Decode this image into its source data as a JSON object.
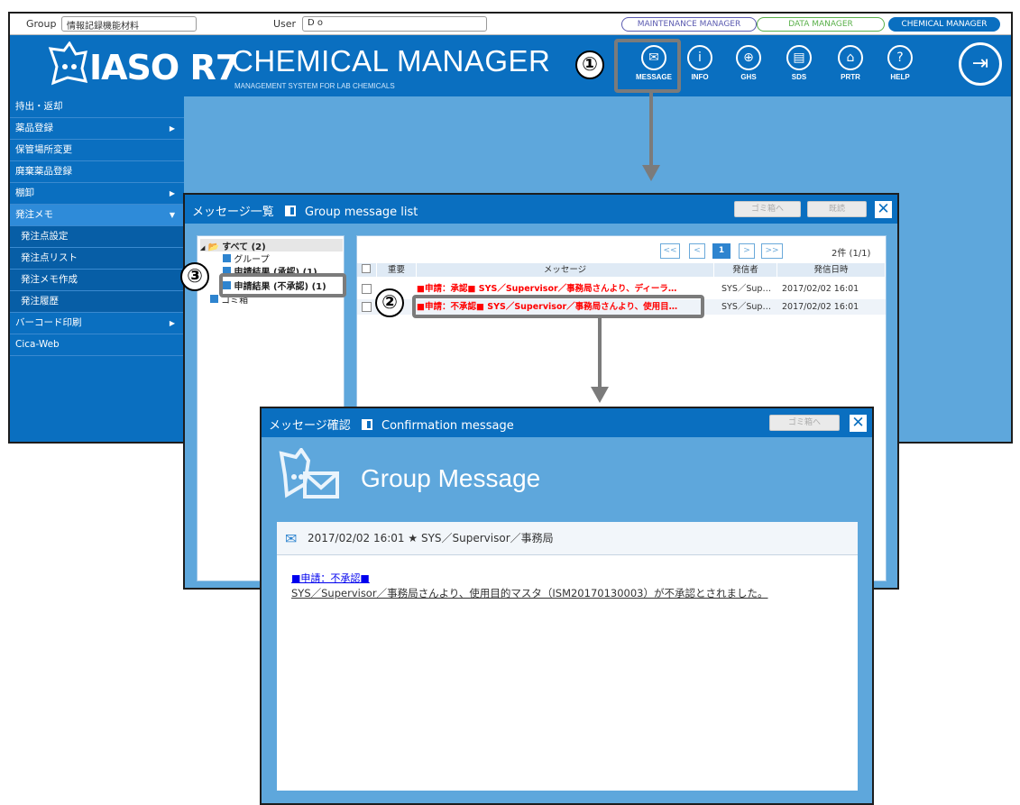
{
  "topbar": {
    "group_label": "Group",
    "group_value": "情報記録機能材料",
    "user_label": "User",
    "user_value": "D o",
    "managers": [
      "MAINTENANCE MANAGER",
      "DATA MANAGER",
      "CHEMICAL MANAGER"
    ]
  },
  "header": {
    "logo": "IASO R7",
    "title": "CHEMICAL MANAGER",
    "subtitle": "MANAGEMENT SYSTEM FOR LAB CHEMICALS",
    "icons": [
      "MESSAGE",
      "INFO",
      "GHS",
      "SDS",
      "PRTR",
      "HELP"
    ]
  },
  "sidebar": {
    "items": [
      {
        "label": "持出・返却"
      },
      {
        "label": "薬品登録",
        "arrow": "▶"
      },
      {
        "label": "保管場所変更"
      },
      {
        "label": "廃棄薬品登録"
      },
      {
        "label": "棚卸",
        "arrow": "▶"
      },
      {
        "label": "発注メモ",
        "arrow": "▼"
      },
      {
        "label": "発注点設定"
      },
      {
        "label": "発注点リスト"
      },
      {
        "label": "発注メモ作成"
      },
      {
        "label": "発注履歴"
      },
      {
        "label": "バーコード印刷",
        "arrow": "▶"
      },
      {
        "label": "Cica-Web"
      }
    ]
  },
  "message_list": {
    "title_jp": "メッセージ一覧",
    "title_en": "Group message list",
    "trash_btn": "ゴミ箱へ",
    "read_btn": "既読",
    "close": "✕",
    "tree": {
      "all": "すべて (2)",
      "group": "グループ",
      "approved": "申請結果 (承認) (1)",
      "rejected": "申請結果 (不承認) (1)",
      "trash": "ゴミ箱"
    },
    "pager": [
      "<<",
      "<",
      "1",
      ">",
      ">>"
    ],
    "count": "2件 (1/1)",
    "columns": [
      "重要",
      "メッセージ",
      "発信者",
      "発信日時"
    ],
    "rows": [
      {
        "message": "■申請：承認■ SYS／Supervisor／事務局さんより、ディーラ…",
        "from": "SYS／Sup…",
        "date": "2017/02/02 16:01"
      },
      {
        "message": "■申請：不承認■ SYS／Supervisor／事務局さんより、使用目…",
        "from": "SYS／Sup…",
        "date": "2017/02/02 16:01"
      }
    ]
  },
  "confirm": {
    "title_jp": "メッセージ確認",
    "title_en": "Confirmation message",
    "trash_btn": "ゴミ箱へ",
    "close": "✕",
    "heading_light": "Group ",
    "heading_bold": "Message",
    "info": "2017/02/02 16:01 ★ SYS／Supervisor／事務局",
    "link": "■申請：不承認■",
    "body": "SYS／Supervisor／事務局さんより、使用目的マスタ（ISM20170130003）が不承認とされました。"
  },
  "annotations": {
    "n1": "①",
    "n2": "②",
    "n3": "③"
  },
  "colors": {
    "brand": "#0a6fc0",
    "panel": "#5ea7dc",
    "alert": "#ff0000",
    "annotation": "#7b7b7b"
  }
}
